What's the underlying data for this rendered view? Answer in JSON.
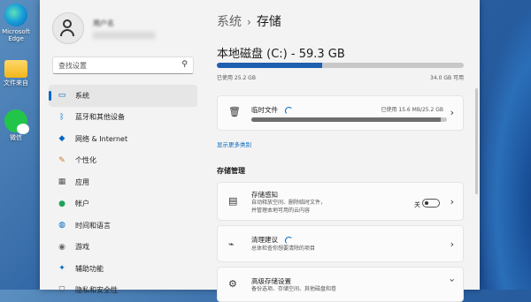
{
  "desktop": {
    "icons": [
      {
        "label": "Microsoft Edge",
        "icon": "edge-icon"
      },
      {
        "label": "文件来自",
        "icon": "folder-icon"
      },
      {
        "label": "微信",
        "icon": "wechat-icon"
      }
    ]
  },
  "sidebar": {
    "user_name": "用户名",
    "search_placeholder": "查找设置",
    "items": [
      {
        "label": "系统",
        "icon": "system-icon",
        "active": true
      },
      {
        "label": "蓝牙和其他设备",
        "icon": "bluetooth-icon"
      },
      {
        "label": "网络 & Internet",
        "icon": "wifi-icon"
      },
      {
        "label": "个性化",
        "icon": "brush-icon"
      },
      {
        "label": "应用",
        "icon": "apps-icon"
      },
      {
        "label": "帐户",
        "icon": "account-icon"
      },
      {
        "label": "时间和语言",
        "icon": "globe-icon"
      },
      {
        "label": "游戏",
        "icon": "gamepad-icon"
      },
      {
        "label": "辅助功能",
        "icon": "accessibility-icon"
      },
      {
        "label": "隐私和安全性",
        "icon": "shield-icon"
      }
    ]
  },
  "main": {
    "breadcrumb_parent": "系统",
    "breadcrumb_sep": "›",
    "breadcrumb_current": "存储",
    "disk_title": "本地磁盘 (C:) - 59.3 GB",
    "used_fraction": 0.425,
    "used_label": "已使用 25.2 GB",
    "available_label": "34.0 GB 可用",
    "temp": {
      "title": "临时文件",
      "size": "已使用 15.6 MB/25.2 GB",
      "fraction": 0.97
    },
    "more_link": "显示更多类别",
    "section_title": "存储管理",
    "sense": {
      "title": "存储感知",
      "desc1": "自动释放空间、删除临时文件，",
      "desc2": "并管理本地可用的云内容",
      "toggle_label": "关"
    },
    "cleanup": {
      "title": "清理建议",
      "desc": "总体检查你想要清除的项目"
    },
    "advanced": {
      "title": "高级存储设置",
      "desc": "备份选项、存储空间、其他磁盘和卷"
    }
  }
}
